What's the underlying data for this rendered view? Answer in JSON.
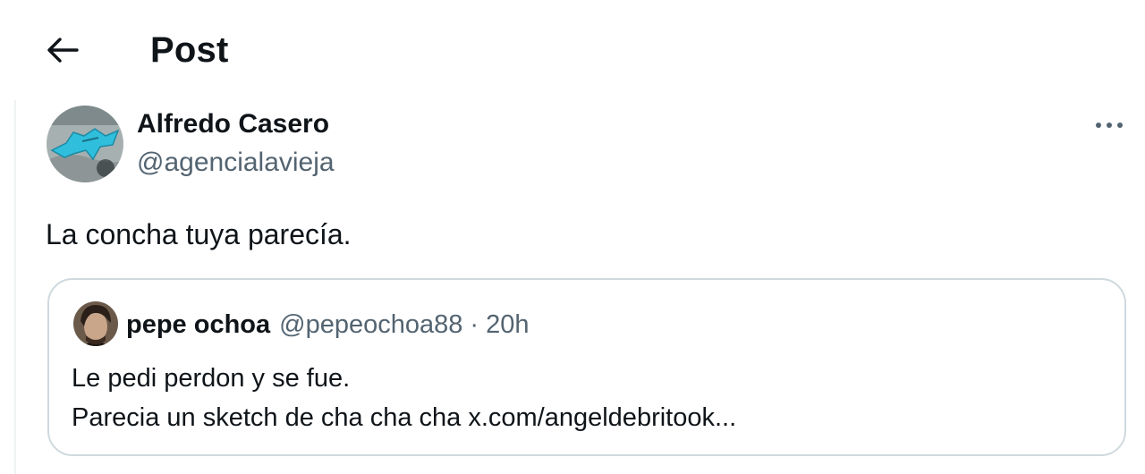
{
  "header": {
    "title": "Post",
    "back_icon": "arrow-left-icon"
  },
  "post": {
    "author": {
      "name": "Alfredo Casero",
      "handle": "@agencialavieja",
      "avatar_colors": [
        "#9aa6a8",
        "#31c0dc"
      ]
    },
    "text": "La concha tuya parecía.",
    "more_icon": "ellipsis-icon"
  },
  "quote": {
    "author": {
      "name": "pepe ochoa",
      "handle": "@pepeochoa88"
    },
    "separator": "·",
    "time": "20h",
    "lines": [
      "Le pedi perdon y se fue.",
      "Parecia un sketch de cha cha cha x.com/angeldebritook..."
    ]
  },
  "colors": {
    "text_primary": "#0f1419",
    "text_secondary": "#536471",
    "border": "#cfd9de"
  }
}
